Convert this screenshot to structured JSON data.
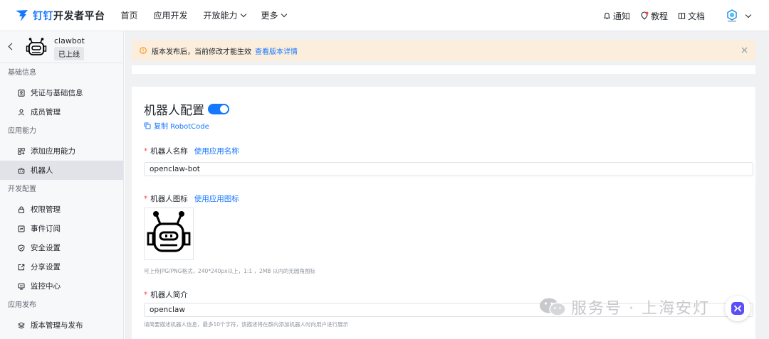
{
  "header": {
    "logo_brand": "钉钉",
    "logo_suffix": "开发者平台",
    "nav": [
      "首页",
      "应用开发",
      "开放能力",
      "更多"
    ],
    "notify": "通知",
    "tutorial": "教程",
    "docs": "文档"
  },
  "sidebar": {
    "app_name": "clawbot",
    "app_status": "已上线",
    "groups": {
      "basic": "基础信息",
      "ability": "应用能力",
      "dev": "开发配置",
      "release": "应用发布"
    },
    "items": {
      "credentials": "凭证与基础信息",
      "members": "成员管理",
      "add_ability": "添加应用能力",
      "robot": "机器人",
      "permissions": "权限管理",
      "events": "事件订阅",
      "security": "安全设置",
      "share": "分享设置",
      "monitor": "监控中心",
      "versions": "版本管理与发布"
    }
  },
  "alert": {
    "text": "版本发布后，当前修改才能生效",
    "link": "查看版本详情"
  },
  "config": {
    "title": "机器人配置",
    "toggle_on": true,
    "copy_code": "复制 RobotCode",
    "name_label": "机器人名称",
    "name_link": "使用应用名称",
    "name_value": "openclaw-bot",
    "icon_label": "机器人图标",
    "icon_link": "使用应用图标",
    "icon_hint": "可上传JPG/PNG格式，240*240px以上，1:1 ，2MB 以内的无圆角图标",
    "intro_label": "机器人简介",
    "intro_value": "openclaw",
    "intro_hint": "请简要描述机器人信息，最多10个字符，该描述将在群内添加机器人时向用户进行展示"
  },
  "watermark": "服务号 · 上海安灯",
  "colors": {
    "accent": "#1677ff",
    "alert_bg": "#fbeedd",
    "required": "#f54a45"
  }
}
